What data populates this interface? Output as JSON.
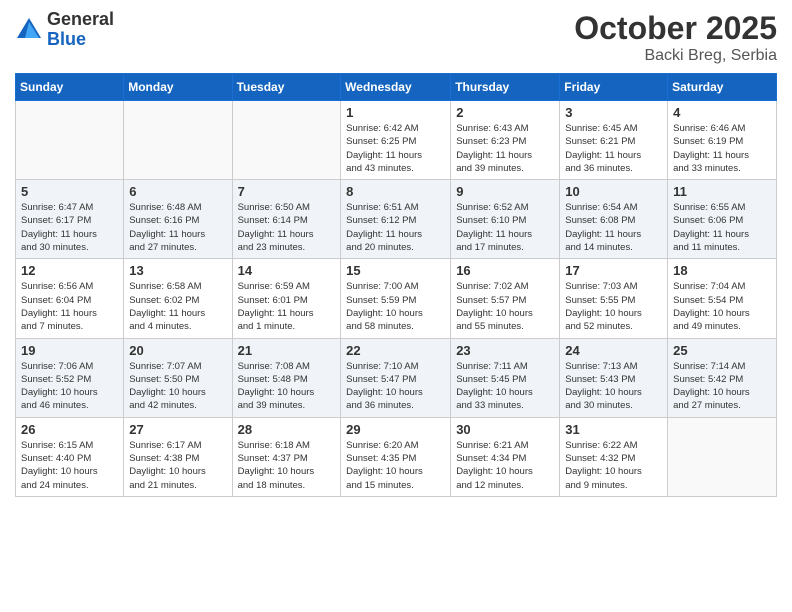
{
  "header": {
    "logo_general": "General",
    "logo_blue": "Blue",
    "month": "October 2025",
    "location": "Backi Breg, Serbia"
  },
  "days_of_week": [
    "Sunday",
    "Monday",
    "Tuesday",
    "Wednesday",
    "Thursday",
    "Friday",
    "Saturday"
  ],
  "weeks": [
    [
      {
        "day": "",
        "info": ""
      },
      {
        "day": "",
        "info": ""
      },
      {
        "day": "",
        "info": ""
      },
      {
        "day": "1",
        "info": "Sunrise: 6:42 AM\nSunset: 6:25 PM\nDaylight: 11 hours\nand 43 minutes."
      },
      {
        "day": "2",
        "info": "Sunrise: 6:43 AM\nSunset: 6:23 PM\nDaylight: 11 hours\nand 39 minutes."
      },
      {
        "day": "3",
        "info": "Sunrise: 6:45 AM\nSunset: 6:21 PM\nDaylight: 11 hours\nand 36 minutes."
      },
      {
        "day": "4",
        "info": "Sunrise: 6:46 AM\nSunset: 6:19 PM\nDaylight: 11 hours\nand 33 minutes."
      }
    ],
    [
      {
        "day": "5",
        "info": "Sunrise: 6:47 AM\nSunset: 6:17 PM\nDaylight: 11 hours\nand 30 minutes."
      },
      {
        "day": "6",
        "info": "Sunrise: 6:48 AM\nSunset: 6:16 PM\nDaylight: 11 hours\nand 27 minutes."
      },
      {
        "day": "7",
        "info": "Sunrise: 6:50 AM\nSunset: 6:14 PM\nDaylight: 11 hours\nand 23 minutes."
      },
      {
        "day": "8",
        "info": "Sunrise: 6:51 AM\nSunset: 6:12 PM\nDaylight: 11 hours\nand 20 minutes."
      },
      {
        "day": "9",
        "info": "Sunrise: 6:52 AM\nSunset: 6:10 PM\nDaylight: 11 hours\nand 17 minutes."
      },
      {
        "day": "10",
        "info": "Sunrise: 6:54 AM\nSunset: 6:08 PM\nDaylight: 11 hours\nand 14 minutes."
      },
      {
        "day": "11",
        "info": "Sunrise: 6:55 AM\nSunset: 6:06 PM\nDaylight: 11 hours\nand 11 minutes."
      }
    ],
    [
      {
        "day": "12",
        "info": "Sunrise: 6:56 AM\nSunset: 6:04 PM\nDaylight: 11 hours\nand 7 minutes."
      },
      {
        "day": "13",
        "info": "Sunrise: 6:58 AM\nSunset: 6:02 PM\nDaylight: 11 hours\nand 4 minutes."
      },
      {
        "day": "14",
        "info": "Sunrise: 6:59 AM\nSunset: 6:01 PM\nDaylight: 11 hours\nand 1 minute."
      },
      {
        "day": "15",
        "info": "Sunrise: 7:00 AM\nSunset: 5:59 PM\nDaylight: 10 hours\nand 58 minutes."
      },
      {
        "day": "16",
        "info": "Sunrise: 7:02 AM\nSunset: 5:57 PM\nDaylight: 10 hours\nand 55 minutes."
      },
      {
        "day": "17",
        "info": "Sunrise: 7:03 AM\nSunset: 5:55 PM\nDaylight: 10 hours\nand 52 minutes."
      },
      {
        "day": "18",
        "info": "Sunrise: 7:04 AM\nSunset: 5:54 PM\nDaylight: 10 hours\nand 49 minutes."
      }
    ],
    [
      {
        "day": "19",
        "info": "Sunrise: 7:06 AM\nSunset: 5:52 PM\nDaylight: 10 hours\nand 46 minutes."
      },
      {
        "day": "20",
        "info": "Sunrise: 7:07 AM\nSunset: 5:50 PM\nDaylight: 10 hours\nand 42 minutes."
      },
      {
        "day": "21",
        "info": "Sunrise: 7:08 AM\nSunset: 5:48 PM\nDaylight: 10 hours\nand 39 minutes."
      },
      {
        "day": "22",
        "info": "Sunrise: 7:10 AM\nSunset: 5:47 PM\nDaylight: 10 hours\nand 36 minutes."
      },
      {
        "day": "23",
        "info": "Sunrise: 7:11 AM\nSunset: 5:45 PM\nDaylight: 10 hours\nand 33 minutes."
      },
      {
        "day": "24",
        "info": "Sunrise: 7:13 AM\nSunset: 5:43 PM\nDaylight: 10 hours\nand 30 minutes."
      },
      {
        "day": "25",
        "info": "Sunrise: 7:14 AM\nSunset: 5:42 PM\nDaylight: 10 hours\nand 27 minutes."
      }
    ],
    [
      {
        "day": "26",
        "info": "Sunrise: 6:15 AM\nSunset: 4:40 PM\nDaylight: 10 hours\nand 24 minutes."
      },
      {
        "day": "27",
        "info": "Sunrise: 6:17 AM\nSunset: 4:38 PM\nDaylight: 10 hours\nand 21 minutes."
      },
      {
        "day": "28",
        "info": "Sunrise: 6:18 AM\nSunset: 4:37 PM\nDaylight: 10 hours\nand 18 minutes."
      },
      {
        "day": "29",
        "info": "Sunrise: 6:20 AM\nSunset: 4:35 PM\nDaylight: 10 hours\nand 15 minutes."
      },
      {
        "day": "30",
        "info": "Sunrise: 6:21 AM\nSunset: 4:34 PM\nDaylight: 10 hours\nand 12 minutes."
      },
      {
        "day": "31",
        "info": "Sunrise: 6:22 AM\nSunset: 4:32 PM\nDaylight: 10 hours\nand 9 minutes."
      },
      {
        "day": "",
        "info": ""
      }
    ]
  ]
}
